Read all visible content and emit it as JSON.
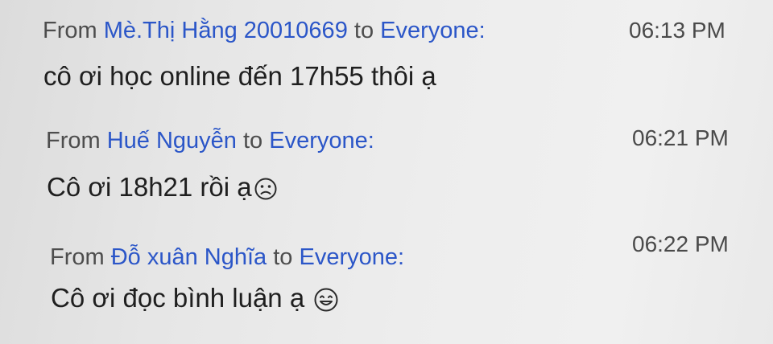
{
  "messages": [
    {
      "from_prefix": "From ",
      "sender": "Mè.Thị Hằng 20010669",
      "to_word": " to ",
      "recipient": "Everyone:",
      "time": "06:13 PM",
      "text": "cô ơi học online đến 17h55 thôi ạ",
      "emoji": ""
    },
    {
      "from_prefix": "From ",
      "sender": "Huế Nguyễn",
      "to_word": " to ",
      "recipient": "Everyone:",
      "time": "06:21 PM",
      "text": "Cô ơi 18h21 rồi ạ",
      "emoji": "sad-face-icon"
    },
    {
      "from_prefix": "From ",
      "sender": "Đỗ xuân Nghĩa",
      "to_word": " to ",
      "recipient": "Everyone:",
      "time": "06:22 PM",
      "text": "Cô ơi đọc bình luận ạ",
      "emoji": "smiling-face-icon"
    }
  ],
  "colors": {
    "sender": "#2b56c8",
    "header_text": "#4a4a4a",
    "body_text": "#1f1f1f",
    "background": "#e9e9e9"
  }
}
